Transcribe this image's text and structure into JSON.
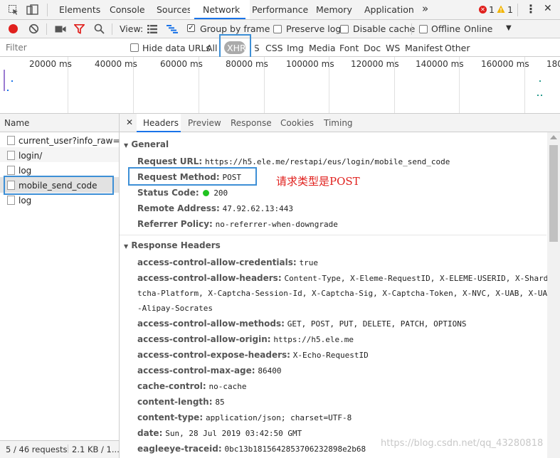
{
  "tabs": {
    "elements": "Elements",
    "console": "Console",
    "sources": "Sources",
    "network": "Network",
    "performance": "Performance",
    "memory": "Memory",
    "application": "Application",
    "more": "»",
    "errors_count": "1",
    "warnings_count": "1",
    "menu": "⋮",
    "close": "✕"
  },
  "toolbar": {
    "view_label": "View:",
    "group_by_frame": "Group by frame",
    "preserve_log": "Preserve log",
    "disable_cache": "Disable cache",
    "offline": "Offline",
    "throttle": "Online"
  },
  "filter": {
    "placeholder": "Filter",
    "hide_data_urls": "Hide data URLs",
    "types": [
      "All",
      "XHR",
      "JS",
      "CSS",
      "Img",
      "Media",
      "Font",
      "Doc",
      "WS",
      "Manifest",
      "Other"
    ]
  },
  "overview": {
    "ticks": [
      "20000 ms",
      "40000 ms",
      "60000 ms",
      "80000 ms",
      "100000 ms",
      "120000 ms",
      "140000 ms",
      "160000 ms",
      "180"
    ]
  },
  "requests": {
    "header": "Name",
    "items": [
      "current_user?info_raw={}",
      "login/",
      "log",
      "mobile_send_code",
      "log"
    ],
    "status": "5 / 46 requests",
    "size": "2.1 KB / 1..."
  },
  "detail": {
    "tabs": [
      "Headers",
      "Preview",
      "Response",
      "Cookies",
      "Timing"
    ],
    "general_title": "General",
    "general": [
      {
        "k": "Request URL:",
        "v": "https://h5.ele.me/restapi/eus/login/mobile_send_code"
      },
      {
        "k": "Request Method:",
        "v": "POST"
      },
      {
        "k": "Status Code:",
        "v": "200"
      },
      {
        "k": "Remote Address:",
        "v": "47.92.62.13:443"
      },
      {
        "k": "Referrer Policy:",
        "v": "no-referrer-when-downgrade"
      }
    ],
    "annotation": "请求类型是POST",
    "response_title": "Response Headers",
    "response": [
      {
        "k": "access-control-allow-credentials:",
        "v": "true"
      },
      {
        "k": "access-control-allow-headers:",
        "v": "Content-Type, X-Eleme-RequestID, X-ELEME-USERID, X-Shard, X-C"
      },
      {
        "k": "",
        "v": "tcha-Platform, X-Captcha-Session-Id, X-Captcha-Sig, X-Captcha-Token, X-NVC, X-UAB, X-UA,"
      },
      {
        "k": "",
        "v": "-Alipay-Socrates"
      },
      {
        "k": "access-control-allow-methods:",
        "v": "GET, POST, PUT, DELETE, PATCH, OPTIONS"
      },
      {
        "k": "access-control-allow-origin:",
        "v": "https://h5.ele.me"
      },
      {
        "k": "access-control-expose-headers:",
        "v": "X-Echo-RequestID"
      },
      {
        "k": "access-control-max-age:",
        "v": "86400"
      },
      {
        "k": "cache-control:",
        "v": "no-cache"
      },
      {
        "k": "content-length:",
        "v": "85"
      },
      {
        "k": "content-type:",
        "v": "application/json; charset=UTF-8"
      },
      {
        "k": "date:",
        "v": "Sun, 28 Jul 2019 03:42:50 GMT"
      },
      {
        "k": "eagleeye-traceid:",
        "v": "0bc13b1815642853706232898e2b68"
      }
    ]
  },
  "watermark": "https://blog.csdn.net/qq_43280818",
  "colors": {
    "highlight": "#3d8fd6",
    "record": "#e0201d",
    "status_ok": "#20c320",
    "annotation": "#e0201d"
  }
}
